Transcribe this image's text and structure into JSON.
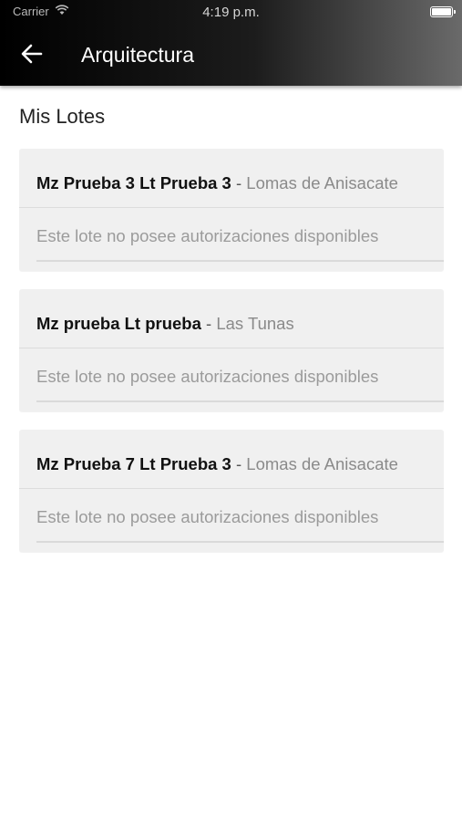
{
  "status_bar": {
    "carrier": "Carrier",
    "time": "4:19 p.m."
  },
  "header": {
    "title": "Arquitectura",
    "back_icon": "arrow-left-icon"
  },
  "section_title": "Mis Lotes",
  "lots": [
    {
      "name": "Mz Prueba 3 Lt Prueba 3",
      "separator": " - ",
      "neighborhood": "Lomas de Anisacate",
      "message": "Este lote no posee autorizaciones disponibles"
    },
    {
      "name": "Mz prueba Lt prueba",
      "separator": " - ",
      "neighborhood": "Las Tunas",
      "message": "Este lote no posee autorizaciones disponibles"
    },
    {
      "name": "Mz Prueba 7 Lt Prueba 3",
      "separator": " - ",
      "neighborhood": "Lomas de Anisacate",
      "message": "Este lote no posee autorizaciones disponibles"
    }
  ],
  "colors": {
    "header_start": "#000000",
    "header_end": "#6a6a6a",
    "card_background": "#f0f0f0",
    "muted_text": "#9b9b9b"
  }
}
